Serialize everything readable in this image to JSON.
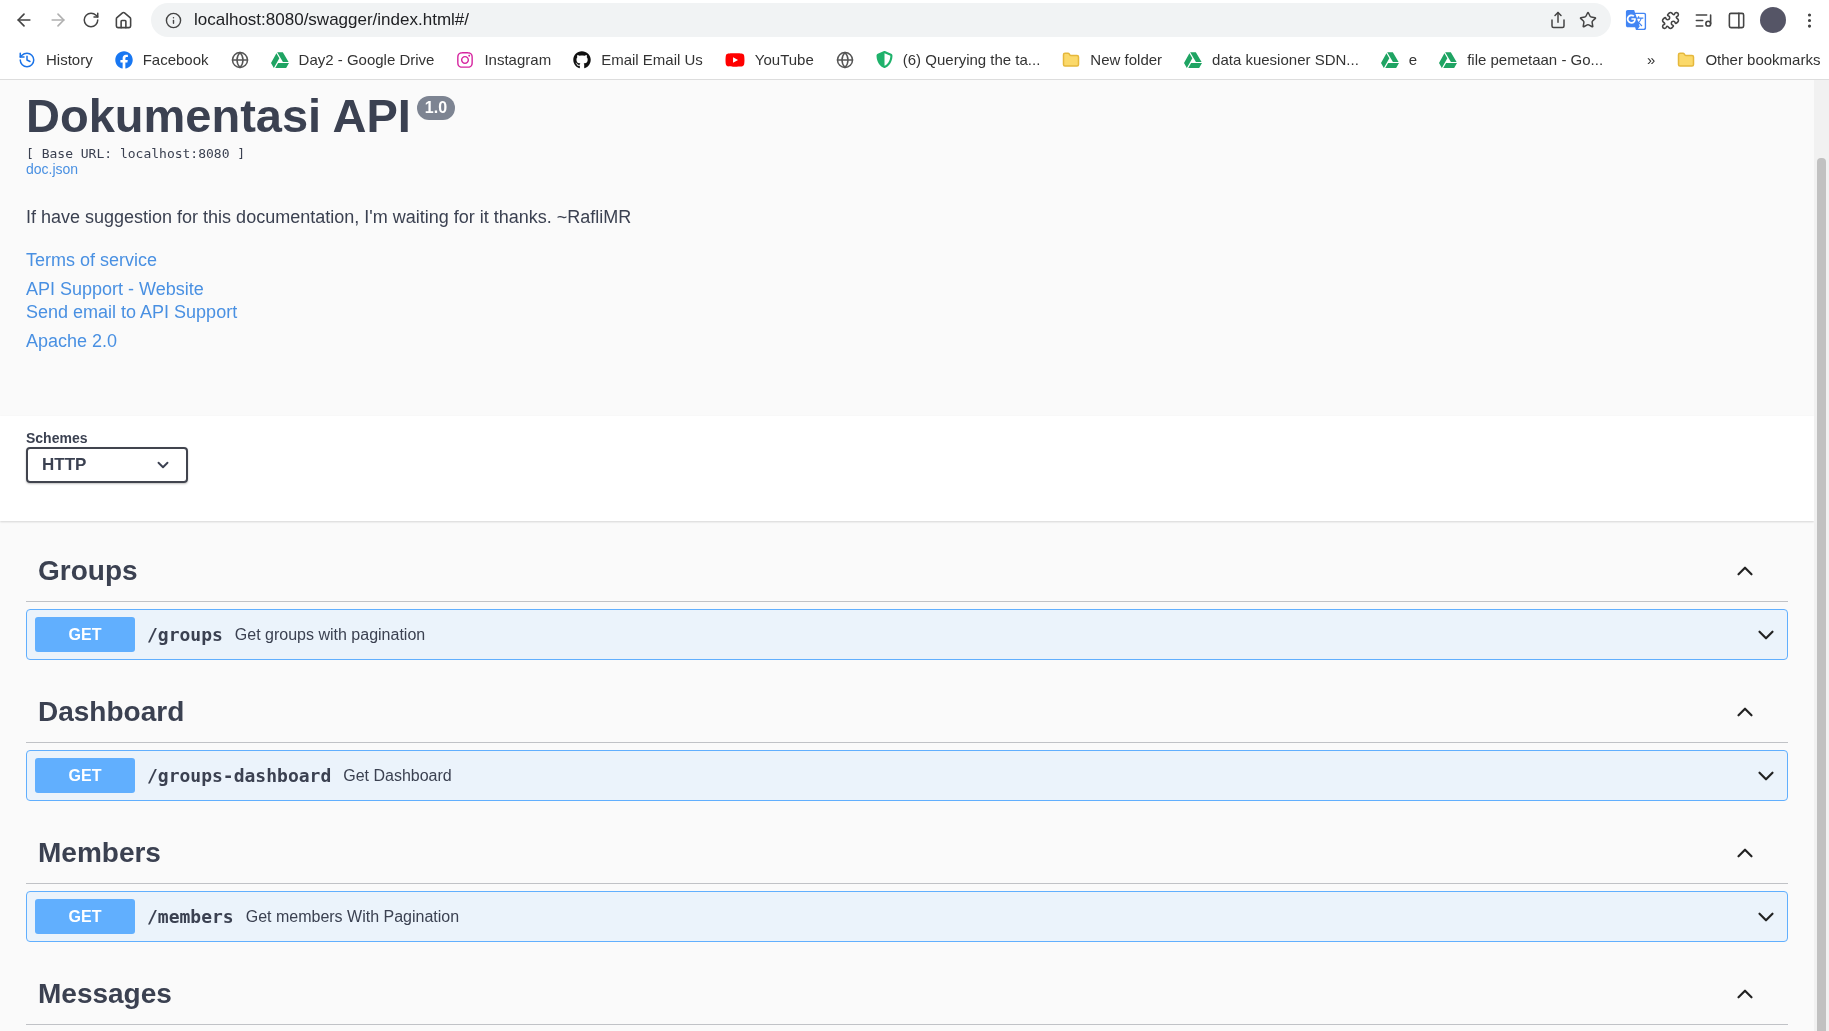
{
  "browser": {
    "url": "localhost:8080/swagger/index.html#/",
    "bookmarks": [
      {
        "kind": "history",
        "label": "History"
      },
      {
        "kind": "facebook",
        "label": "Facebook"
      },
      {
        "kind": "globe"
      },
      {
        "kind": "drive",
        "label": "Day2 - Google Drive"
      },
      {
        "kind": "instagram",
        "label": "Instagram"
      },
      {
        "kind": "github",
        "label": "Email Email Us"
      },
      {
        "kind": "youtube",
        "label": "YouTube"
      },
      {
        "kind": "globe"
      },
      {
        "kind": "shield",
        "label": "(6) Querying the ta..."
      },
      {
        "kind": "folder",
        "label": "New folder"
      },
      {
        "kind": "drive",
        "label": "data kuesioner SDN..."
      },
      {
        "kind": "drive",
        "label": "e"
      },
      {
        "kind": "drive",
        "label": "file pemetaan - Go..."
      }
    ],
    "overflow": "»",
    "other_bookmarks": "Other bookmarks"
  },
  "info": {
    "title": "Dokumentasi API",
    "version": "1.0",
    "base_url": "[ Base URL: localhost:8080 ]",
    "spec_link": "doc.json",
    "description": "If have suggestion for this documentation, I'm waiting for it thanks. ~RafliMR",
    "links": [
      [
        "Terms of service"
      ],
      [
        "API Support - Website",
        "Send email to API Support"
      ],
      [
        "Apache 2.0"
      ]
    ]
  },
  "schemes": {
    "label": "Schemes",
    "value": "HTTP"
  },
  "sections": [
    {
      "name": "Groups",
      "expanded": true,
      "operations": [
        {
          "method": "GET",
          "path": "/groups",
          "summary": "Get groups with pagination",
          "expanded": false
        }
      ]
    },
    {
      "name": "Dashboard",
      "expanded": true,
      "operations": [
        {
          "method": "GET",
          "path": "/groups-dashboard",
          "summary": "Get Dashboard",
          "expanded": false
        }
      ]
    },
    {
      "name": "Members",
      "expanded": true,
      "operations": [
        {
          "method": "GET",
          "path": "/members",
          "summary": "Get members With Pagination",
          "expanded": false
        }
      ]
    },
    {
      "name": "Messages",
      "expanded": true
    }
  ]
}
